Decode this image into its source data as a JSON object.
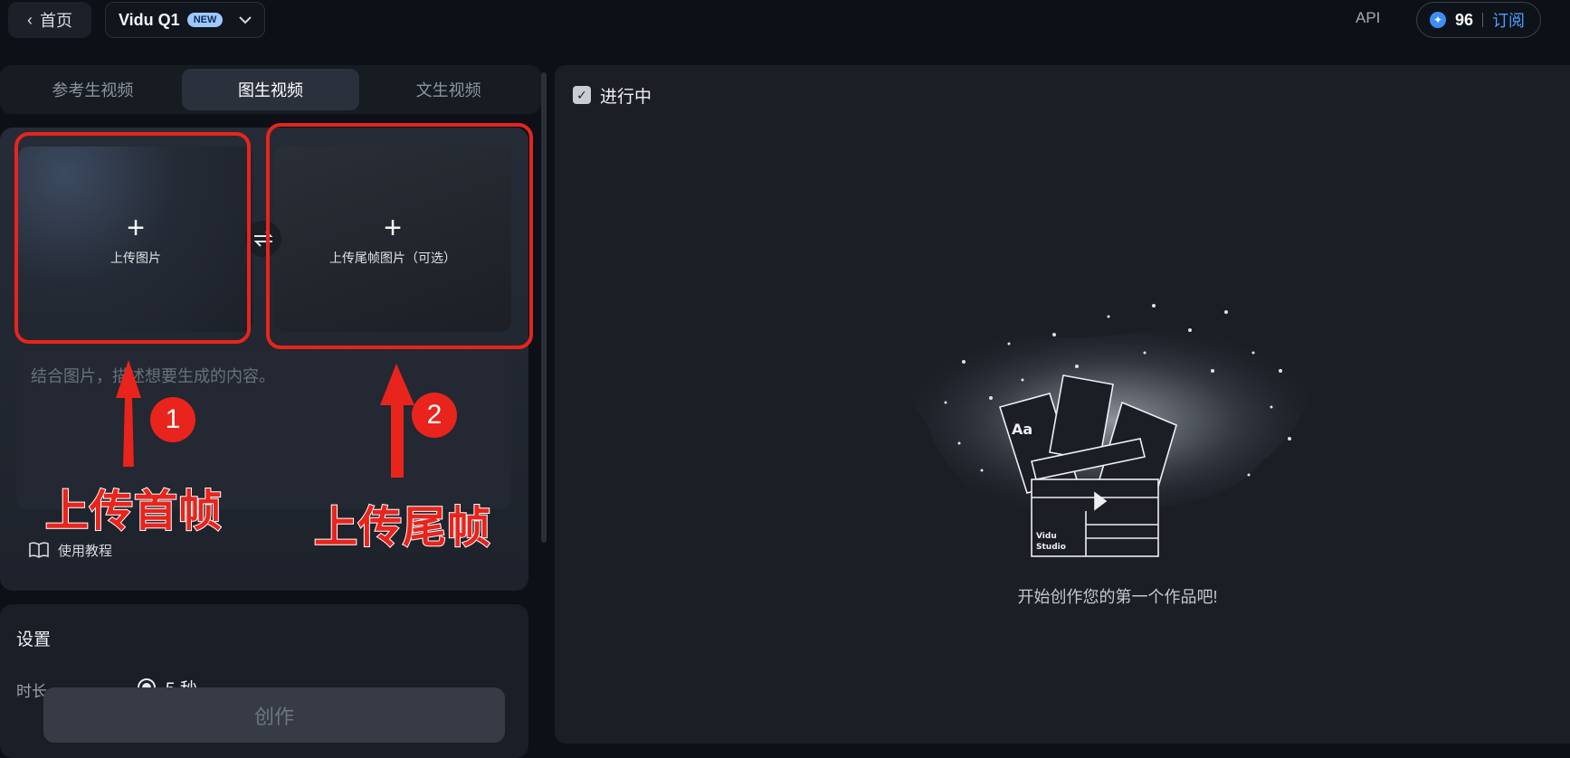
{
  "header": {
    "back_label": "首页",
    "model_name": "Vidu Q1",
    "model_badge": "NEW",
    "api_label": "API",
    "credits": "96",
    "subscribe_label": "订阅"
  },
  "tabs": [
    {
      "label": "参考生视频",
      "active": false
    },
    {
      "label": "图生视频",
      "active": true
    },
    {
      "label": "文生视频",
      "active": false
    }
  ],
  "upload": {
    "first_label": "上传图片",
    "last_label": "上传尾帧图片（可选）",
    "prompt_placeholder": "结合图片，描述想要生成的内容。",
    "tutorial_label": "使用教程"
  },
  "settings": {
    "title": "设置",
    "duration_label": "时长",
    "duration_value": "5 秒"
  },
  "create_label": "创作",
  "right": {
    "in_progress_label": "进行中",
    "empty_message": "开始创作您的第一个作品吧!",
    "illustration_text_aa": "Aa",
    "illustration_brand": "Vidu",
    "illustration_brand_sub": "Studio"
  },
  "annotations": {
    "marker_1": "1",
    "marker_2": "2",
    "text_1": "上传首帧",
    "text_2": "上传尾帧",
    "color": "#e8241c"
  },
  "colors": {
    "accent": "#4c9dff",
    "coin": "#3d8ef5",
    "background": "#0d1016"
  }
}
